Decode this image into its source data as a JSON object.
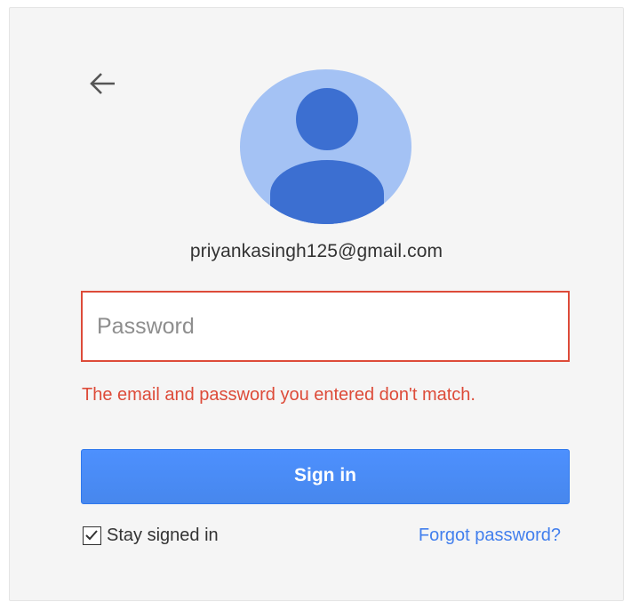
{
  "account": {
    "email": "priyankasingh125@gmail.com"
  },
  "password": {
    "placeholder": "Password",
    "value": ""
  },
  "error": {
    "message": "The email and password you entered don't match."
  },
  "signin": {
    "label": "Sign in"
  },
  "stay_signed_in": {
    "label": "Stay signed in",
    "checked": true
  },
  "forgot": {
    "label": "Forgot password?"
  },
  "icons": {
    "back": "arrow-left-icon",
    "avatar": "default-user-avatar-icon",
    "check": "checkmark-icon"
  },
  "colors": {
    "error": "#dd4b39",
    "button": "#4d90fe",
    "link": "#427fed",
    "avatar_bg": "#a4c2f4",
    "avatar_fg": "#3c6fd1"
  }
}
